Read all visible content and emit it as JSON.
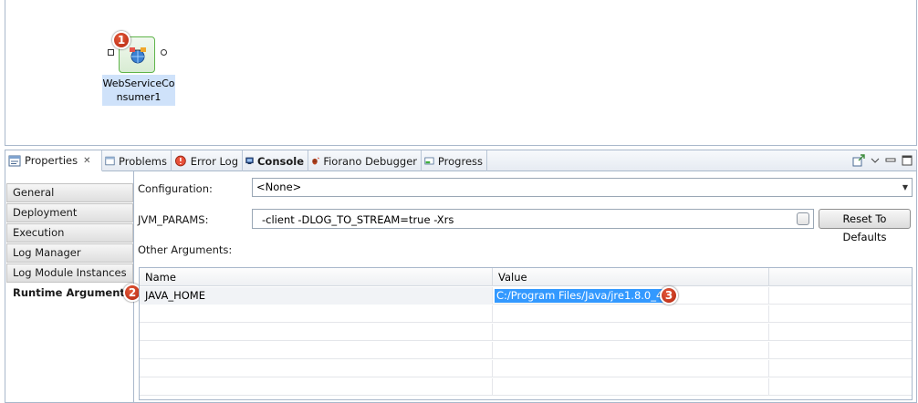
{
  "canvas": {
    "node": {
      "label": "WebServiceConsumer1",
      "icon": "web-service-consumer-icon"
    },
    "callouts": [
      "1",
      "2",
      "3"
    ]
  },
  "view": {
    "tabs": [
      {
        "label": "Properties",
        "icon": "properties-icon",
        "active": true
      },
      {
        "label": "Problems",
        "icon": "problems-icon"
      },
      {
        "label": "Error Log",
        "icon": "error-log-icon"
      },
      {
        "label": "Console",
        "icon": "console-icon"
      },
      {
        "label": "Fiorano Debugger",
        "icon": "debugger-icon"
      },
      {
        "label": "Progress",
        "icon": "progress-icon"
      }
    ],
    "tools": [
      "pin-icon",
      "view-menu-icon",
      "minimize-icon",
      "maximize-icon"
    ]
  },
  "nav": {
    "items": [
      "General",
      "Deployment",
      "Execution",
      "Log Manager",
      "Log Module Instances",
      "Runtime Arguments"
    ],
    "selected": "Runtime Arguments"
  },
  "form": {
    "configuration_label": "Configuration:",
    "configuration_value": "<None>",
    "jvm_params_label": "JVM_PARAMS:",
    "jvm_params_value": "-client -DLOG_TO_STREAM=true -Xrs",
    "reset_button": "Reset To Defaults",
    "other_arguments_label": "Other Arguments:"
  },
  "table": {
    "columns": [
      "Name",
      "Value"
    ],
    "rows": [
      {
        "name": "JAVA_HOME",
        "value": "C:/Program Files/Java/jre1.8.0_45"
      }
    ]
  },
  "colors": {
    "selection": "#3399ff",
    "callout": "#c23a1c",
    "node_border": "#5fb44a",
    "label_highlight": "#cfe2fa"
  }
}
